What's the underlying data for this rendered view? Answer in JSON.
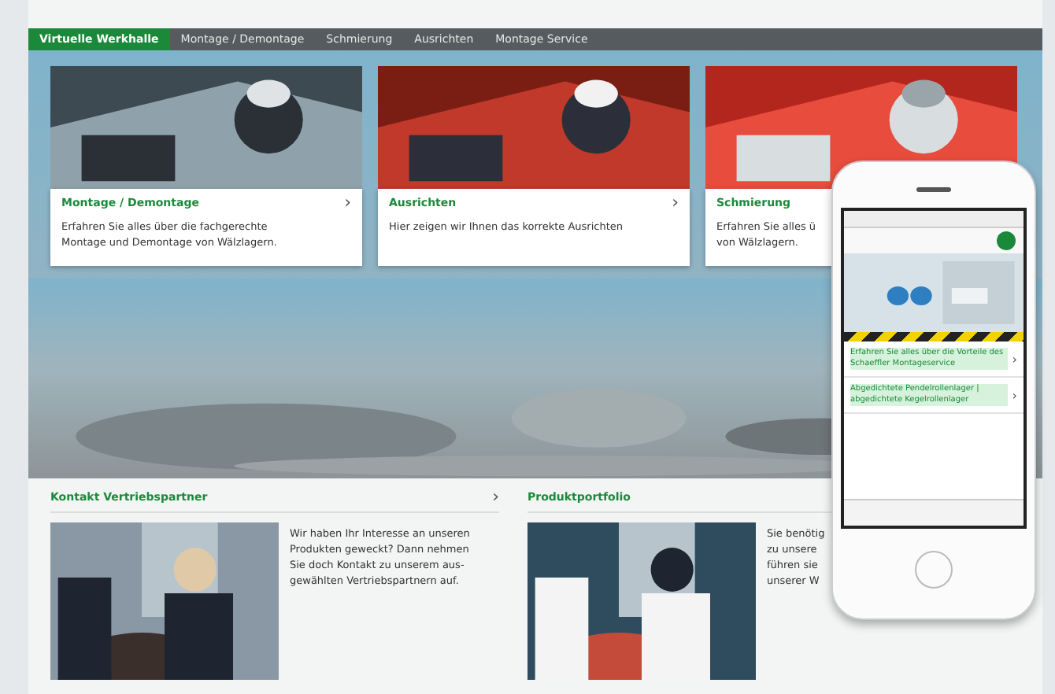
{
  "nav": {
    "tabs": [
      {
        "label": "Virtuelle Werkhalle",
        "selected": true
      },
      {
        "label": "Montage / Demontage",
        "selected": false
      },
      {
        "label": "Schmierung",
        "selected": false
      },
      {
        "label": "Ausrichten",
        "selected": false
      },
      {
        "label": "Montage Service",
        "selected": false
      }
    ]
  },
  "hero_cards": [
    {
      "title": "Montage / Demontage",
      "chevron": "›",
      "lines": [
        "Erfahren Sie alles über die fachgerechte",
        "Montage und Demontage von Wälzlagern."
      ]
    },
    {
      "title": "Ausrichten",
      "chevron": "›",
      "lines": [
        "Hier zeigen wir Ihnen das korrekte Ausrichten"
      ]
    },
    {
      "title": "Schmierung",
      "lines": [
        "Erfahren Sie alles ü",
        "von Wälzlagern."
      ]
    }
  ],
  "sections": [
    {
      "title": "Kontakt Vertriebspartner",
      "chevron": "›",
      "lines": [
        "Wir haben Ihr Interesse an unseren",
        "Produkten geweckt? Dann nehmen",
        "Sie doch Kontakt zu unserem aus-",
        "gewählten Vertriebspartnern auf."
      ]
    },
    {
      "title": "Produktportfolio",
      "lines": [
        "Sie benötig",
        "zu unsere",
        "führen sie",
        "unserer W"
      ]
    }
  ],
  "phone": {
    "links": [
      {
        "text": "Erfahren Sie alles über die Vorteile des Schaeffler Montageservice",
        "chevron": "›"
      },
      {
        "text": "Abgedichtete Pendelrollenlager | abgedichtete Kegelrollenlager",
        "chevron": "›"
      }
    ]
  }
}
